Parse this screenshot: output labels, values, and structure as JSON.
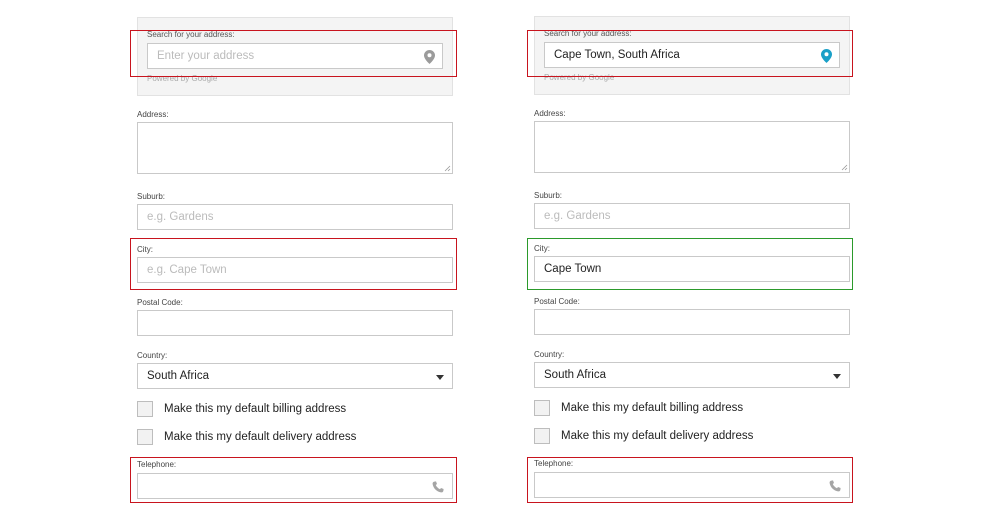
{
  "left_form": {
    "search": {
      "label": "Search for your address:",
      "placeholder": "Enter your address",
      "value": "",
      "powered_by": "Powered by Google"
    },
    "address": {
      "label": "Address:"
    },
    "suburb": {
      "label": "Suburb:",
      "placeholder": "e.g. Gardens",
      "value": ""
    },
    "city": {
      "label": "City:",
      "placeholder": "e.g. Cape Town",
      "value": ""
    },
    "postal_code": {
      "label": "Postal Code:"
    },
    "country": {
      "label": "Country:",
      "value": "South Africa"
    },
    "billing_checkbox": {
      "label": "Make this my default billing address",
      "checked": false
    },
    "delivery_checkbox": {
      "label": "Make this my default delivery address",
      "checked": false
    },
    "telephone": {
      "label": "Telephone:"
    }
  },
  "right_form": {
    "search": {
      "label": "Search for your address:",
      "value": "Cape Town, South Africa",
      "powered_by": "Powered by Google"
    },
    "address": {
      "label": "Address:"
    },
    "suburb": {
      "label": "Suburb:",
      "placeholder": "e.g. Gardens",
      "value": ""
    },
    "city": {
      "label": "City:",
      "value": "Cape Town"
    },
    "postal_code": {
      "label": "Postal Code:"
    },
    "country": {
      "label": "Country:",
      "value": "South Africa"
    },
    "billing_checkbox": {
      "label": "Make this my default billing address",
      "checked": false
    },
    "delivery_checkbox": {
      "label": "Make this my default delivery address",
      "checked": false
    },
    "telephone": {
      "label": "Telephone:"
    }
  },
  "icons": {
    "pin": "map-pin-icon",
    "phone": "phone-icon",
    "caret": "chevron-down-icon"
  },
  "colors": {
    "highlight_red": "#c8141e",
    "highlight_green": "#2b9a2b",
    "pin_inactive": "#9b9b9b",
    "pin_active": "#1aa0c8"
  }
}
